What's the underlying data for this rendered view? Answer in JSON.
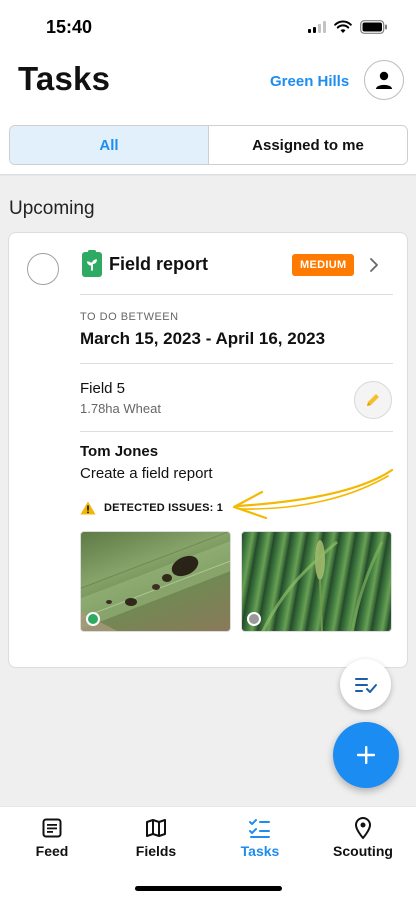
{
  "status_bar": {
    "time": "15:40"
  },
  "header": {
    "title": "Tasks",
    "farm_name": "Green Hills"
  },
  "tabs": [
    {
      "label": "All",
      "active": true
    },
    {
      "label": "Assigned to me",
      "active": false
    }
  ],
  "section_title": "Upcoming",
  "task_card": {
    "title": "Field report",
    "priority": "MEDIUM",
    "todo_label": "TO DO BETWEEN",
    "date_range": "March 15, 2023 - April 16, 2023",
    "field_name": "Field 5",
    "field_info": "1.78ha Wheat",
    "assignee": "Tom Jones",
    "description": "Create a field report",
    "issues_label": "DETECTED ISSUES: 1"
  },
  "bottom_nav": [
    {
      "label": "Feed",
      "icon": "document-icon",
      "active": false
    },
    {
      "label": "Fields",
      "icon": "map-icon",
      "active": false
    },
    {
      "label": "Tasks",
      "icon": "checklist-icon",
      "active": true
    },
    {
      "label": "Scouting",
      "icon": "location-pin-icon",
      "active": false
    }
  ],
  "colors": {
    "accent": "#1d8ef0",
    "priority_medium": "#ff7a00",
    "report_icon": "#2eaa63",
    "warning": "#f2b705",
    "annotation": "#f5b800"
  }
}
